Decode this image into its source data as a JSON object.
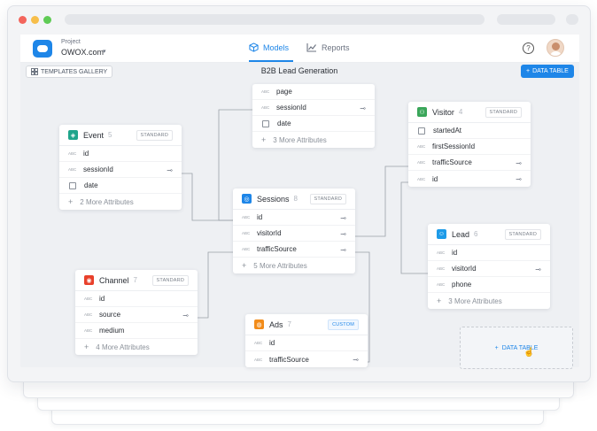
{
  "project": {
    "label": "Project",
    "name": "OWOX.com"
  },
  "nav": {
    "models": "Models",
    "reports": "Reports"
  },
  "toolbar": {
    "templates": "TEMPLATES GALLERY",
    "title": "B2B Lead Generation",
    "add_table": "DATA TABLE"
  },
  "colors": {
    "accent": "#1e86e8",
    "event": "#1fa58b",
    "sessions": "#1e86e8",
    "channel": "#e8402b",
    "ads": "#f28c1a",
    "visitor": "#3aa65a",
    "lead": "#1e9be8"
  },
  "tables": {
    "top": {
      "rows": [
        {
          "type": "ABC",
          "name": "page"
        },
        {
          "type": "ABC",
          "name": "sessionId"
        },
        {
          "type": "DATE",
          "name": "date"
        }
      ],
      "more": "3 More Attributes"
    },
    "event": {
      "name": "Event",
      "count": "5",
      "badge": "STANDARD",
      "rows": [
        {
          "type": "ABC",
          "name": "id"
        },
        {
          "type": "ABC",
          "name": "sessionId"
        },
        {
          "type": "DATE",
          "name": "date"
        }
      ],
      "more": "2 More Attributes"
    },
    "sessions": {
      "name": "Sessions",
      "count": "8",
      "badge": "STANDARD",
      "rows": [
        {
          "type": "ABC",
          "name": "id"
        },
        {
          "type": "ABC",
          "name": "visitorId"
        },
        {
          "type": "ABC",
          "name": "trafficSource"
        }
      ],
      "more": "5 More Attributes"
    },
    "visitor": {
      "name": "Visitor",
      "count": "4",
      "badge": "STANDARD",
      "rows": [
        {
          "type": "DATE",
          "name": "startedAt"
        },
        {
          "type": "ABC",
          "name": "firstSessionId"
        },
        {
          "type": "ABC",
          "name": "trafficSource"
        },
        {
          "type": "ABC",
          "name": "id"
        }
      ]
    },
    "lead": {
      "name": "Lead",
      "count": "6",
      "badge": "STANDARD",
      "rows": [
        {
          "type": "ABC",
          "name": "id"
        },
        {
          "type": "ABC",
          "name": "visitorId"
        },
        {
          "type": "ABC",
          "name": "phone"
        }
      ],
      "more": "3 More Attributes"
    },
    "channel": {
      "name": "Channel",
      "count": "7",
      "badge": "STANDARD",
      "rows": [
        {
          "type": "ABC",
          "name": "id"
        },
        {
          "type": "ABC",
          "name": "source"
        },
        {
          "type": "ABC",
          "name": "medium"
        }
      ],
      "more": "4 More Attributes"
    },
    "ads": {
      "name": "Ads",
      "count": "7",
      "badge": "CUSTOM",
      "rows": [
        {
          "type": "ABC",
          "name": "id"
        },
        {
          "type": "ABC",
          "name": "trafficSource"
        }
      ]
    }
  },
  "placeholder": {
    "label": "DATA TABLE"
  }
}
